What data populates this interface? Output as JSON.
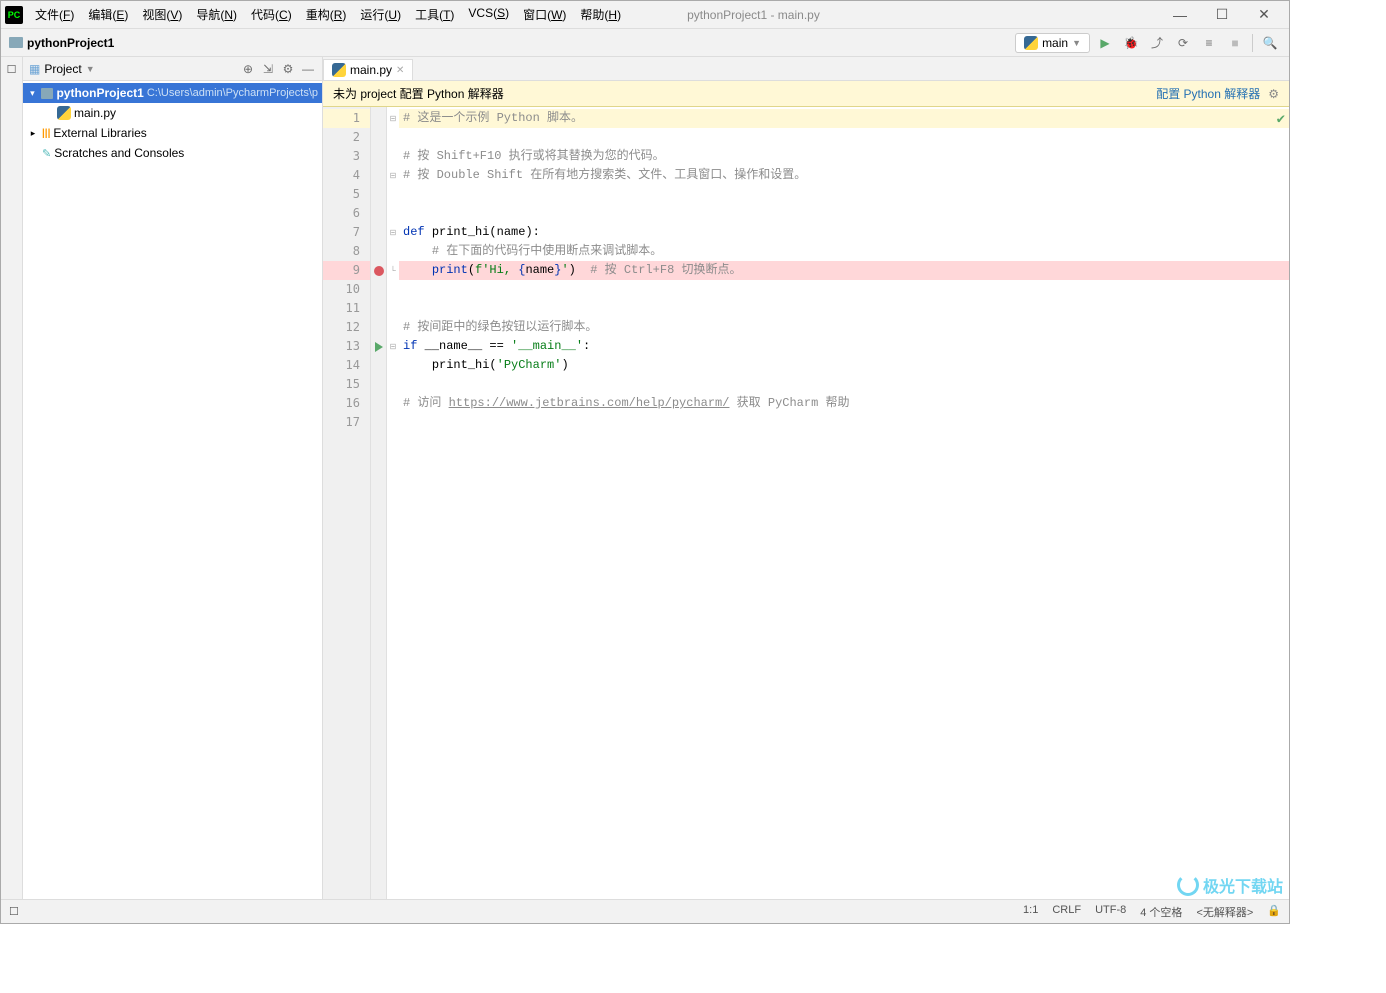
{
  "title_bar": {
    "window_title": "pythonProject1 - main.py",
    "menu": [
      {
        "label": "文件",
        "key": "F"
      },
      {
        "label": "编辑",
        "key": "E"
      },
      {
        "label": "视图",
        "key": "V"
      },
      {
        "label": "导航",
        "key": "N"
      },
      {
        "label": "代码",
        "key": "C"
      },
      {
        "label": "重构",
        "key": "R"
      },
      {
        "label": "运行",
        "key": "U"
      },
      {
        "label": "工具",
        "key": "T"
      },
      {
        "label": "VCS",
        "key": "S"
      },
      {
        "label": "窗口",
        "key": "W"
      },
      {
        "label": "帮助",
        "key": "H"
      }
    ]
  },
  "nav_bar": {
    "breadcrumb": "pythonProject1",
    "run_config": "main"
  },
  "project_panel": {
    "title": "Project",
    "root": {
      "name": "pythonProject1",
      "path": "C:\\Users\\admin\\PycharmProjects\\p"
    },
    "files": [
      "main.py"
    ],
    "external": "External Libraries",
    "scratches": "Scratches and Consoles"
  },
  "editor": {
    "tab": "main.py",
    "banner": {
      "text": "未为 project 配置 Python 解释器",
      "link": "配置 Python 解释器"
    },
    "lines": [
      {
        "n": 1,
        "hl": true,
        "fold": "⊟",
        "tokens": [
          {
            "t": "# 这是一个示例 Python 脚本。",
            "c": "cmt"
          }
        ]
      },
      {
        "n": 2
      },
      {
        "n": 3,
        "tokens": [
          {
            "t": "# 按 Shift+F10 执行或将其替换为您的代码。",
            "c": "cmt"
          }
        ]
      },
      {
        "n": 4,
        "fold": "⊟",
        "tokens": [
          {
            "t": "# 按 Double Shift 在所有地方搜索类、文件、工具窗口、操作和设置。",
            "c": "cmt"
          }
        ]
      },
      {
        "n": 5
      },
      {
        "n": 6
      },
      {
        "n": 7,
        "fold": "⊟",
        "tokens": [
          {
            "t": "def ",
            "c": "kw"
          },
          {
            "t": "print_hi",
            "c": "fn"
          },
          {
            "t": "(",
            "c": "pr"
          },
          {
            "t": "name",
            "c": "pr"
          },
          {
            "t": "):",
            "c": "pr"
          }
        ]
      },
      {
        "n": 8,
        "indent": 1,
        "tokens": [
          {
            "t": "# 在下面的代码行中使用断点来调试脚本。",
            "c": "cmt"
          }
        ]
      },
      {
        "n": 9,
        "bp": true,
        "indent": 1,
        "fold": "└",
        "tokens": [
          {
            "t": "print",
            "c": "bi"
          },
          {
            "t": "(",
            "c": "pr"
          },
          {
            "t": "f'Hi, ",
            "c": "str"
          },
          {
            "t": "{",
            "c": "kw"
          },
          {
            "t": "name",
            "c": "pr"
          },
          {
            "t": "}",
            "c": "kw"
          },
          {
            "t": "'",
            "c": "str"
          },
          {
            "t": ")",
            "c": "pr"
          },
          {
            "t": "  # 按 Ctrl+F8 切换断点。",
            "c": "cmt"
          }
        ]
      },
      {
        "n": 10
      },
      {
        "n": 11
      },
      {
        "n": 12,
        "tokens": [
          {
            "t": "# 按间距中的绿色按钮以运行脚本。",
            "c": "cmt"
          }
        ]
      },
      {
        "n": 13,
        "run": true,
        "fold": "⊟",
        "tokens": [
          {
            "t": "if ",
            "c": "kw"
          },
          {
            "t": "__name__ ",
            "c": "pr"
          },
          {
            "t": "== ",
            "c": "pr"
          },
          {
            "t": "'__main__'",
            "c": "str"
          },
          {
            "t": ":",
            "c": "pr"
          }
        ]
      },
      {
        "n": 14,
        "indent": 1,
        "tokens": [
          {
            "t": "print_hi(",
            "c": "pr"
          },
          {
            "t": "'PyCharm'",
            "c": "str"
          },
          {
            "t": ")",
            "c": "pr"
          }
        ]
      },
      {
        "n": 15
      },
      {
        "n": 16,
        "tokens": [
          {
            "t": "# 访问 ",
            "c": "cmt"
          },
          {
            "t": "https://www.jetbrains.com/help/pycharm/",
            "c": "lnk"
          },
          {
            "t": " 获取 PyCharm 帮助",
            "c": "cmt"
          }
        ]
      },
      {
        "n": 17
      }
    ]
  },
  "status_bar": {
    "pos": "1:1",
    "eol": "CRLF",
    "enc": "UTF-8",
    "indent": "4 个空格",
    "interp": "<无解释器>"
  },
  "watermark": "极光下载站"
}
